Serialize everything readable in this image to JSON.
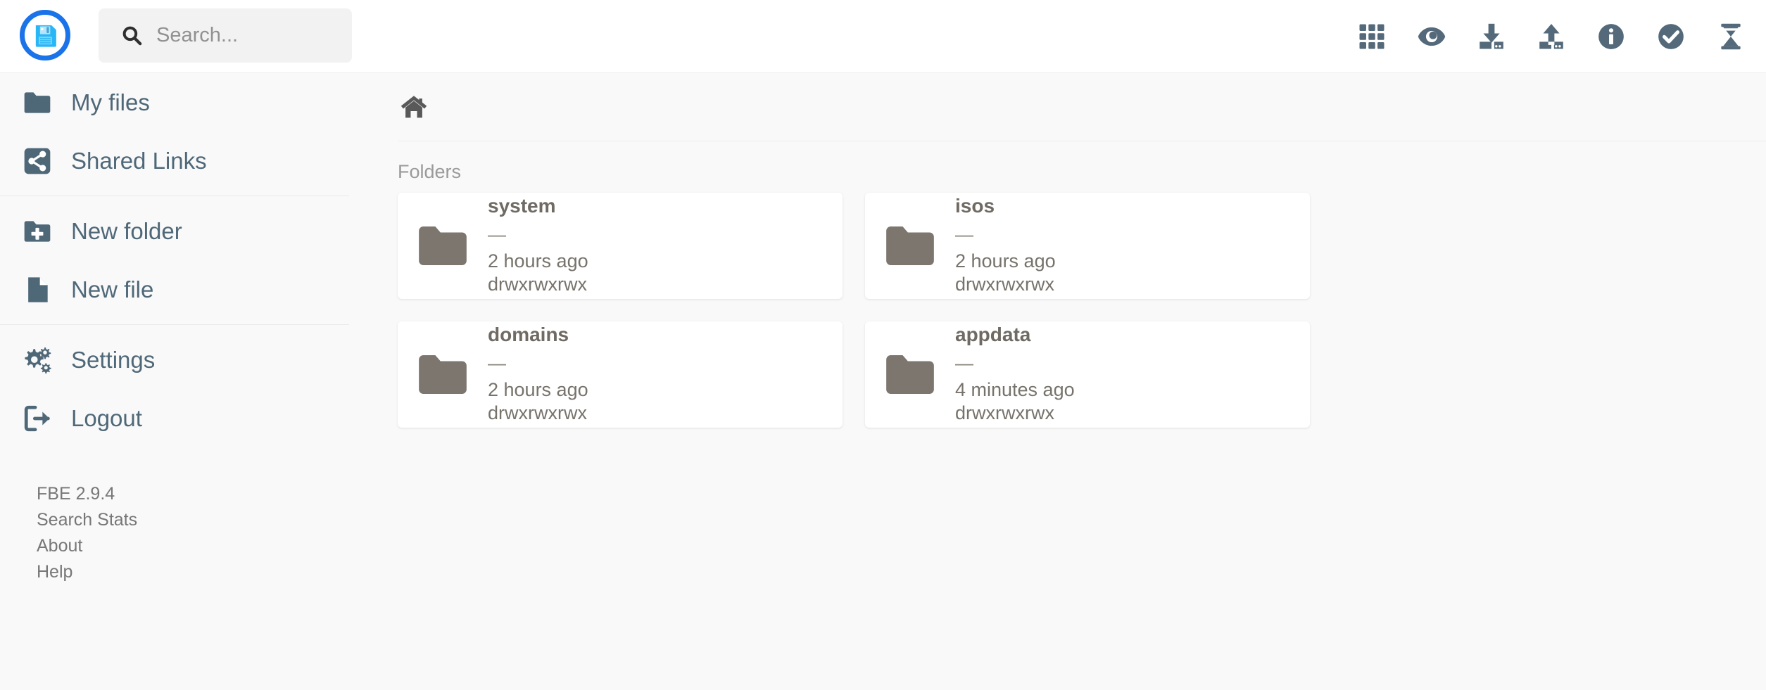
{
  "app": {
    "logo_icon": "floppy-disk-icon",
    "accent_color": "#1a73e8",
    "background_color": "#f9f9f9",
    "sidebar_text_color": "#4f6878",
    "folder_icon_color": "#7d766e"
  },
  "search": {
    "placeholder": "Search...",
    "value": "",
    "icon": "search-icon"
  },
  "toolbar": {
    "buttons": [
      {
        "name": "grid-view-button",
        "icon": "grid-icon",
        "label": "Grid view"
      },
      {
        "name": "preview-button",
        "icon": "eye-icon",
        "label": "Preview"
      },
      {
        "name": "download-button",
        "icon": "download-icon",
        "label": "Download"
      },
      {
        "name": "upload-button",
        "icon": "upload-icon",
        "label": "Upload"
      },
      {
        "name": "info-button",
        "icon": "info-circle-icon",
        "label": "Info"
      },
      {
        "name": "select-button",
        "icon": "check-circle-icon",
        "label": "Select"
      },
      {
        "name": "queue-button",
        "icon": "hourglass-icon",
        "label": "Queue"
      }
    ]
  },
  "sidebar": {
    "groups": [
      {
        "items": [
          {
            "label": "My files",
            "icon": "folder-icon",
            "name": "sidebar-item-my-files"
          },
          {
            "label": "Shared Links",
            "icon": "share-icon",
            "name": "sidebar-item-shared-links"
          }
        ]
      },
      {
        "items": [
          {
            "label": "New folder",
            "icon": "folder-plus-icon",
            "name": "sidebar-item-new-folder"
          },
          {
            "label": "New file",
            "icon": "file-icon",
            "name": "sidebar-item-new-file"
          }
        ]
      },
      {
        "items": [
          {
            "label": "Settings",
            "icon": "gears-icon",
            "name": "sidebar-item-settings"
          },
          {
            "label": "Logout",
            "icon": "logout-icon",
            "name": "sidebar-item-logout"
          }
        ]
      }
    ],
    "footer": [
      {
        "label": "FBE 2.9.4",
        "name": "version-label",
        "link": false
      },
      {
        "label": "Search Stats",
        "name": "footer-link-search-stats",
        "link": true
      },
      {
        "label": "About",
        "name": "footer-link-about",
        "link": true
      },
      {
        "label": "Help",
        "name": "footer-link-help",
        "link": true
      }
    ]
  },
  "main": {
    "breadcrumb": {
      "home_icon": "home-icon",
      "path": ""
    },
    "section_label": "Folders",
    "folders": [
      {
        "name": "system",
        "size": "—",
        "modified": "2 hours ago",
        "permissions": "drwxrwxrwx"
      },
      {
        "name": "isos",
        "size": "—",
        "modified": "2 hours ago",
        "permissions": "drwxrwxrwx"
      },
      {
        "name": "domains",
        "size": "—",
        "modified": "2 hours ago",
        "permissions": "drwxrwxrwx"
      },
      {
        "name": "appdata",
        "size": "—",
        "modified": "4 minutes ago",
        "permissions": "drwxrwxrwx"
      }
    ]
  }
}
